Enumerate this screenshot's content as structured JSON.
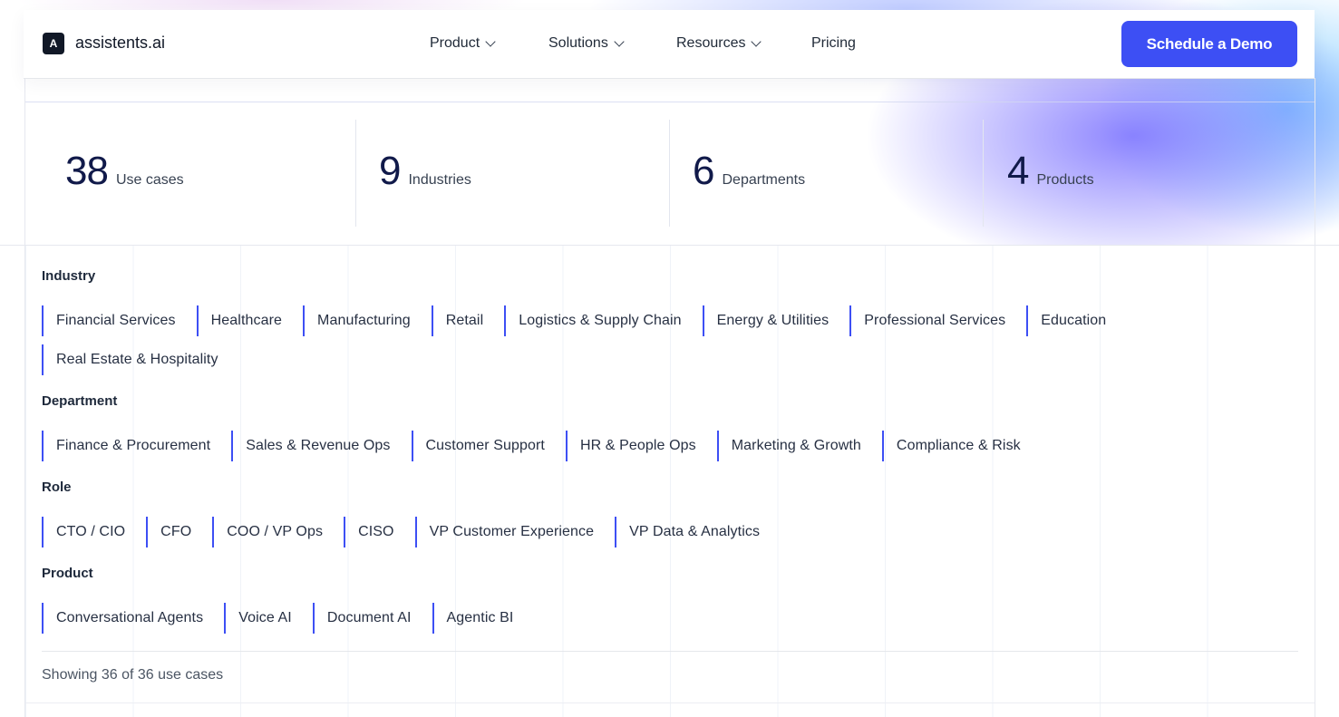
{
  "brand": {
    "logo_letter": "A",
    "name": "assistents.ai"
  },
  "nav": {
    "items": [
      {
        "label": "Product",
        "has_dropdown": true
      },
      {
        "label": "Solutions",
        "has_dropdown": true
      },
      {
        "label": "Resources",
        "has_dropdown": true
      },
      {
        "label": "Pricing",
        "has_dropdown": false
      }
    ],
    "cta_label": "Schedule a Demo"
  },
  "stats": [
    {
      "value": "38",
      "label": "Use cases"
    },
    {
      "value": "9",
      "label": "Industries"
    },
    {
      "value": "6",
      "label": "Departments"
    },
    {
      "value": "4",
      "label": "Products"
    }
  ],
  "filters": {
    "industry": {
      "title": "Industry",
      "options": [
        "Financial Services",
        "Healthcare",
        "Manufacturing",
        "Retail",
        "Logistics & Supply Chain",
        "Energy & Utilities",
        "Professional Services",
        "Education",
        "Real Estate & Hospitality"
      ]
    },
    "department": {
      "title": "Department",
      "options": [
        "Finance & Procurement",
        "Sales & Revenue Ops",
        "Customer Support",
        "HR & People Ops",
        "Marketing & Growth",
        "Compliance & Risk"
      ]
    },
    "role": {
      "title": "Role",
      "options": [
        "CTO / CIO",
        "CFO",
        "COO / VP Ops",
        "CISO",
        "VP Customer Experience",
        "VP Data & Analytics"
      ]
    },
    "product": {
      "title": "Product",
      "options": [
        "Conversational Agents",
        "Voice AI",
        "Document AI",
        "Agentic BI"
      ]
    }
  },
  "results": {
    "summary": "Showing 36 of 36 use cases"
  },
  "colors": {
    "accent": "#3d4ff4",
    "heading": "#111a4a"
  }
}
